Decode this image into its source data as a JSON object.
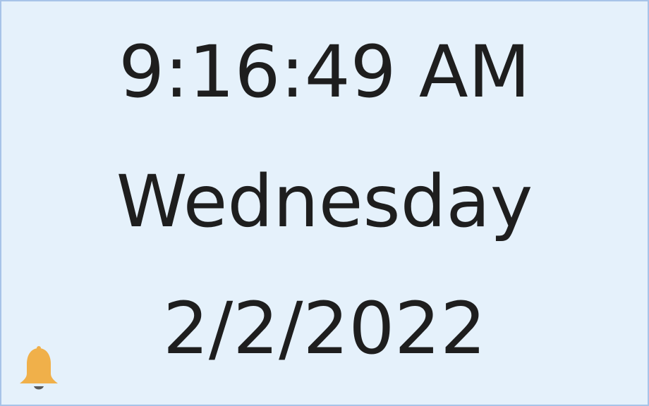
{
  "clock": {
    "time": "9:16:49 AM",
    "weekday": "Wednesday",
    "date": "2/2/2022"
  },
  "icons": {
    "alarm": "bell-icon"
  },
  "colors": {
    "background": "#e5f1fb",
    "border": "#a7c3e8",
    "text": "#1e1e1e",
    "bell": "#f0b04a"
  }
}
